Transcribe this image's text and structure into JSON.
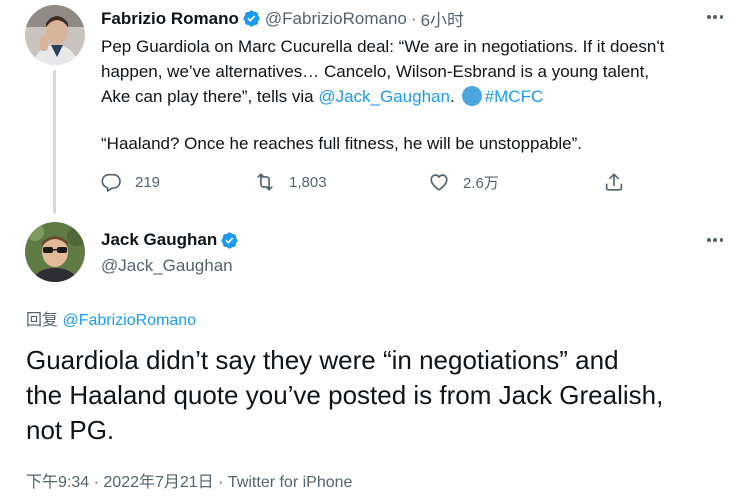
{
  "tweet1": {
    "display_name": "Fabrizio Romano",
    "handle": "@FabrizioRomano",
    "separator": "·",
    "time": "6小时",
    "lines": [
      "Pep Guardiola on Marc Cucurella deal: “We are in negotiations. If it doesn't",
      "happen, we’ve alternatives… Cancelo, Wilson-Esbrand is a young talent,"
    ],
    "line3_text": "Ake can play there”, tells via ",
    "line3_mention": "@Jack_Gaughan",
    "line3_period": ".",
    "hashtag": "#MCFC",
    "quote2": "“Haaland? Once he reaches full fitness, he will be unstoppable”.",
    "reply_count": "219",
    "retweet_count": "1,803",
    "like_count": "2.6万"
  },
  "tweet2": {
    "display_name": "Jack Gaughan",
    "handle": "@Jack_Gaughan",
    "replying_prefix": "回复",
    "replying_handle": "@FabrizioRomano",
    "text_lines": [
      "Guardiola didn’t say they were “in negotiations” and",
      "the Haaland quote you’ve posted is from Jack Grealish,",
      "not PG."
    ],
    "meta_time": "下午9:34",
    "meta_sep1": "·",
    "meta_date": "2022年7月21日",
    "meta_sep2": "·",
    "meta_source": "Twitter for iPhone"
  },
  "icons": {
    "verified": "verified-badge-icon",
    "more": "more-options-icon",
    "reply": "reply-icon",
    "retweet": "retweet-icon",
    "like": "heart-icon",
    "share": "share-icon"
  },
  "colors": {
    "link": "#1d9bf0",
    "secondary_text": "#536471",
    "primary_text": "#0f1419",
    "thread_line": "#cfd9de"
  }
}
